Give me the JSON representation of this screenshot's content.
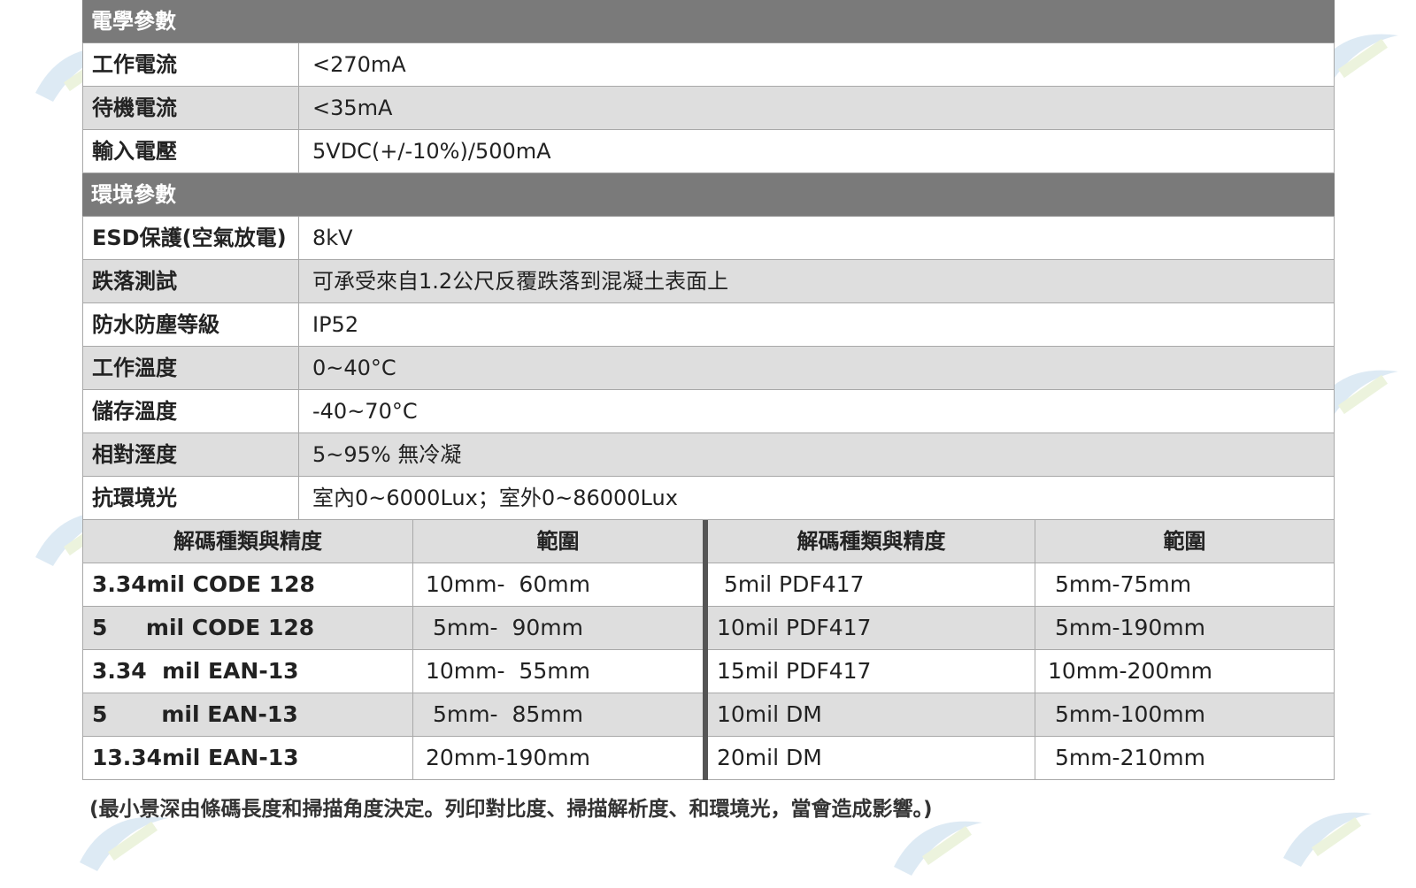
{
  "sections": {
    "electrical": {
      "title": "電學參數",
      "rows": [
        {
          "label": "工作電流",
          "value": "<270mA"
        },
        {
          "label": "待機電流",
          "value": "<35mA"
        },
        {
          "label": "輸入電壓",
          "value": "5VDC(+/-10%)/500mA"
        }
      ]
    },
    "environment": {
      "title": "環境參數",
      "rows": [
        {
          "label": "ESD保護(空氣放電)",
          "value": "8kV"
        },
        {
          "label": "跌落測試",
          "value": "可承受來自1.2公尺反覆跌落到混凝土表面上"
        },
        {
          "label": "防水防塵等級",
          "value": "IP52"
        },
        {
          "label": "工作溫度",
          "value": "0~40°C"
        },
        {
          "label": "儲存溫度",
          "value": "-40~70°C"
        },
        {
          "label": "相對溼度",
          "value": "5~95% 無冷凝"
        },
        {
          "label": "抗環境光",
          "value": "室內0~6000Lux；室外0~86000Lux"
        }
      ]
    }
  },
  "decode": {
    "left": {
      "headers": [
        "解碼種類與精度",
        "範圍"
      ],
      "rows": [
        {
          "type": "3.34mil CODE 128",
          "range": "10mm-  60mm"
        },
        {
          "type": "5     mil CODE 128",
          "range": " 5mm-  90mm"
        },
        {
          "type": "3.34  mil EAN-13",
          "range": "10mm-  55mm"
        },
        {
          "type": "5       mil EAN-13",
          "range": " 5mm-  85mm"
        },
        {
          "type": "13.34mil EAN-13",
          "range": "20mm-190mm"
        }
      ]
    },
    "right": {
      "headers": [
        "解碼種類與精度",
        "範圍"
      ],
      "rows": [
        {
          "type": " 5mil PDF417",
          "range": " 5mm-75mm"
        },
        {
          "type": "10mil PDF417",
          "range": " 5mm-190mm"
        },
        {
          "type": "15mil PDF417",
          "range": "10mm-200mm"
        },
        {
          "type": "10mil DM",
          "range": " 5mm-100mm"
        },
        {
          "type": "20mil DM",
          "range": " 5mm-210mm"
        }
      ]
    }
  },
  "footnote": "(最小景深由條碼長度和掃描角度決定。列印對比度、掃描解析度、和環境光，當會造成影響。)",
  "colors": {
    "section_header_bg": "#7a7a7a",
    "row_gray": "#dedede",
    "row_white": "#ffffff"
  }
}
